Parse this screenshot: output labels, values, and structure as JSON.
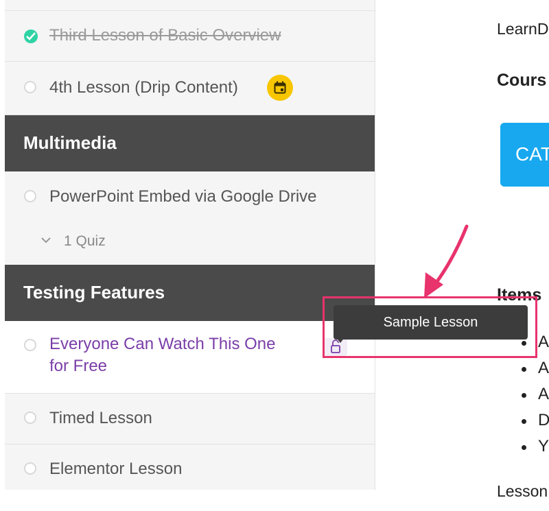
{
  "sidebar": {
    "lesson_third": "Third Lesson of Basic Overview",
    "lesson_fourth": "4th Lesson (Drip Content)",
    "section_multimedia": "Multimedia",
    "lesson_powerpoint": "PowerPoint Embed via Google Drive",
    "quiz_count": "1 Quiz",
    "section_testing": "Testing Features",
    "lesson_everyone_line1": "Everyone Can Watch This One",
    "lesson_everyone_line2": "for Free",
    "lesson_timed": "Timed Lesson",
    "lesson_elementor": "Elementor Lesson"
  },
  "tooltip": {
    "text": "Sample Lesson"
  },
  "main": {
    "text_top": "LearnD",
    "heading_course": "Cours",
    "cat_button": "CAT",
    "heading_items": "Items",
    "bullets": [
      "A",
      "A",
      "A",
      "D",
      "Y"
    ],
    "text_bottom": "Lesson"
  },
  "colors": {
    "section_bg": "#4a4a4a",
    "check_green": "#2ed3a4",
    "drip_yellow": "#f7c600",
    "link_purple": "#7a3ea8",
    "cat_blue": "#17a8f0",
    "callout_pink": "#e8336d"
  }
}
